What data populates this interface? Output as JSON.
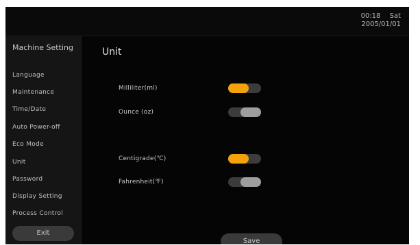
{
  "header": {
    "time": "00:18",
    "weekday": "Sat",
    "date": "2005/01/01"
  },
  "sidebar": {
    "title": "Machine Setting",
    "items": [
      {
        "label": "Language"
      },
      {
        "label": "Maintenance"
      },
      {
        "label": "Time/Date"
      },
      {
        "label": "Auto Power-off"
      },
      {
        "label": "Eco Mode"
      },
      {
        "label": "Unit"
      },
      {
        "label": "Password"
      },
      {
        "label": "Display Setting"
      },
      {
        "label": "Process Control"
      }
    ],
    "exit_label": "Exit"
  },
  "main": {
    "title": "Unit",
    "settings": [
      {
        "label": "Milliliter(ml)",
        "enabled": true
      },
      {
        "label": "Ounce (oz)",
        "enabled": false
      },
      {
        "label": "Centigrade(℃)",
        "enabled": true
      },
      {
        "label": "Fahrenheit(℉)",
        "enabled": false
      }
    ],
    "save_label": "Save"
  },
  "colors": {
    "toggle_on": "#f3a20c",
    "toggle_off": "#9e9e9e",
    "toggle_track": "#3c3c3c",
    "background": "#050505"
  }
}
